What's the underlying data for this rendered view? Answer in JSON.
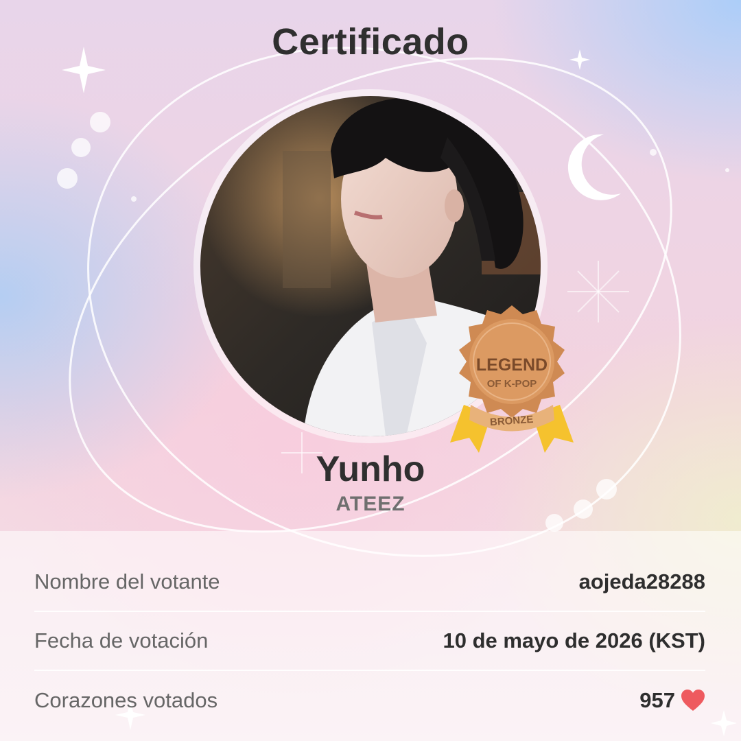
{
  "certificate": {
    "title": "Certificado",
    "idol_name": "Yunho",
    "group_name": "ATEEZ"
  },
  "badge": {
    "line1": "LEGEND",
    "line2": "OF K-POP",
    "tier": "BRONZE",
    "icon": "rosette-badge-icon",
    "color": "#d9955a"
  },
  "details": [
    {
      "label": "Nombre del votante",
      "value": "aojeda28288"
    },
    {
      "label": "Fecha de votación",
      "value": "10 de mayo de 2026 (KST)"
    },
    {
      "label": "Corazones votados",
      "value": "957",
      "icon": "heart-icon"
    }
  ],
  "colors": {
    "heart": "#ee5a5f",
    "title_text": "#2f2f2f"
  }
}
